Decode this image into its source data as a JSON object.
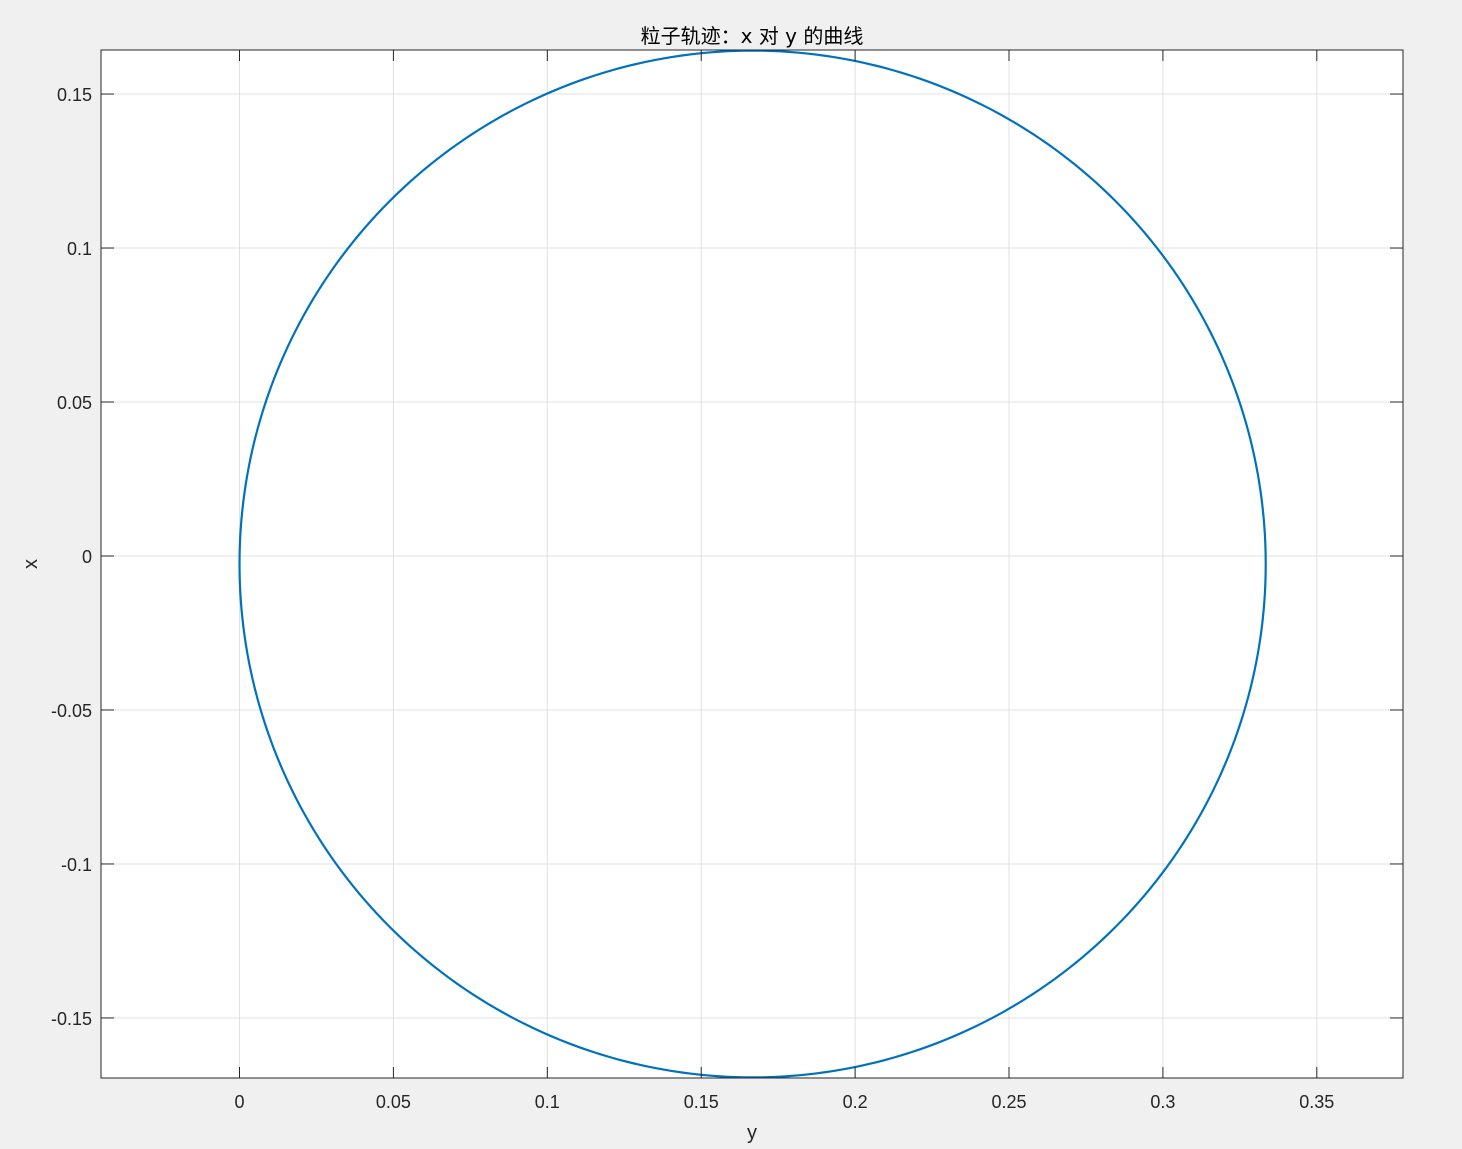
{
  "chart_data": {
    "type": "line",
    "title": "粒子轨迹：x 对 y 的曲线",
    "xlabel": "y",
    "ylabel": "x",
    "xlim": [
      -0.045,
      0.378
    ],
    "ylim": [
      -0.1695,
      0.1643
    ],
    "grid": true,
    "xticks": [
      0,
      0.05,
      0.1,
      0.15,
      0.2,
      0.25,
      0.3,
      0.35
    ],
    "xtick_labels": [
      "0",
      "0.05",
      "0.1",
      "0.15",
      "0.2",
      "0.25",
      "0.3",
      "0.35"
    ],
    "yticks": [
      0.15,
      0.1,
      0.05,
      0,
      -0.05,
      -0.1,
      -0.15
    ],
    "ytick_labels": [
      "0.15",
      "0.1",
      "0.05",
      "0",
      "-0.05",
      "-0.1",
      "-0.15"
    ],
    "series": [
      {
        "color": "#0072bd",
        "shape": "circle",
        "center": [
          0.1667,
          -0.0026
        ],
        "radius_x": 0.1667,
        "radius_y": 0.1667,
        "x": [
          0.1667,
          0.2098,
          0.25,
          0.2846,
          0.3111,
          0.3277,
          0.3334,
          0.3277,
          0.3111,
          0.2846,
          0.25,
          0.2098,
          0.1667,
          0.1236,
          0.0833,
          0.0488,
          0.0223,
          0.0057,
          0.0,
          0.0057,
          0.0223,
          0.0488,
          0.0833,
          0.1236,
          0.1667
        ],
        "y": [
          0.1641,
          0.1584,
          0.1418,
          0.1152,
          0.0807,
          0.0405,
          -0.0026,
          -0.0457,
          -0.0859,
          -0.1205,
          -0.147,
          -0.1636,
          -0.1693,
          -0.1636,
          -0.147,
          -0.1205,
          -0.0859,
          -0.0457,
          -0.0026,
          0.0405,
          0.0807,
          0.1152,
          0.1418,
          0.1584,
          0.1641
        ]
      }
    ]
  }
}
